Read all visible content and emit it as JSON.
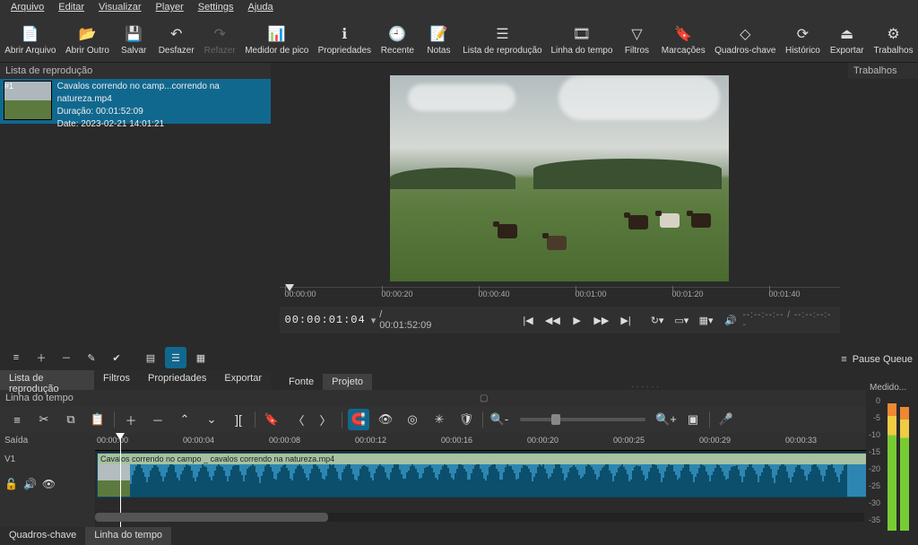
{
  "menu": [
    "Arquivo",
    "Editar",
    "Visualizar",
    "Player",
    "Settings",
    "Ajuda"
  ],
  "toolbar": [
    {
      "icon": "open",
      "label": "Abrir Arquivo"
    },
    {
      "icon": "open-other",
      "label": "Abrir Outro"
    },
    {
      "icon": "save",
      "label": "Salvar"
    },
    {
      "icon": "undo",
      "label": "Desfazer"
    },
    {
      "icon": "redo",
      "label": "Refazer",
      "disabled": true
    },
    {
      "icon": "peak",
      "label": "Medidor de pico"
    },
    {
      "icon": "props",
      "label": "Propriedades"
    },
    {
      "icon": "recent",
      "label": "Recente"
    },
    {
      "icon": "notes",
      "label": "Notas"
    },
    {
      "icon": "playlist",
      "label": "Lista de reprodução"
    },
    {
      "icon": "timeline",
      "label": "Linha do tempo"
    },
    {
      "icon": "filters",
      "label": "Filtros"
    },
    {
      "icon": "markers",
      "label": "Marcações"
    },
    {
      "icon": "keyframes",
      "label": "Quadros-chave"
    },
    {
      "icon": "history",
      "label": "Histórico"
    },
    {
      "icon": "export",
      "label": "Exportar"
    },
    {
      "icon": "jobs",
      "label": "Trabalhos"
    }
  ],
  "playlist": {
    "title": "Lista de reprodução",
    "item": {
      "name": "Cavalos correndo no camp...correndo na natureza.mp4",
      "duration_label": "Duração: 00:01:52:09",
      "date_label": "Date: 2023-02-21 14:01:21"
    },
    "tabs": [
      "Lista de reprodução",
      "Filtros",
      "Propriedades",
      "Exportar"
    ]
  },
  "jobs_panel": {
    "title": "Trabalhos"
  },
  "preview": {
    "ruler_ticks": [
      "00:00:00",
      "00:00:20",
      "00:00:40",
      "00:01:00",
      "00:01:20",
      "00:01:40"
    ],
    "timecode": "00:00:01:04",
    "total": "/ 00:01:52:09",
    "tc_right": "--:--:--:-- / --:--:--:--",
    "source_tabs": [
      "Fonte",
      "Projeto"
    ]
  },
  "pause_queue": "Pause Queue",
  "timeline": {
    "title": "Linha do tempo",
    "output_label": "Saída",
    "track_label": "V1",
    "clip_name": "Cavalos correndo no campo _ cavalos correndo na natureza.mp4",
    "ruler": [
      "00:00:00",
      "00:00:04",
      "00:00:08",
      "00:00:12",
      "00:00:16",
      "00:00:20",
      "00:00:25",
      "00:00:29",
      "00:00:33"
    ]
  },
  "meters": {
    "title": "Medido...",
    "labels": [
      "0",
      "-5",
      "-10",
      "-15",
      "-20",
      "-25",
      "-30",
      "-35"
    ]
  },
  "bottom_tabs": [
    "Quadros-chave",
    "Linha do tempo"
  ]
}
